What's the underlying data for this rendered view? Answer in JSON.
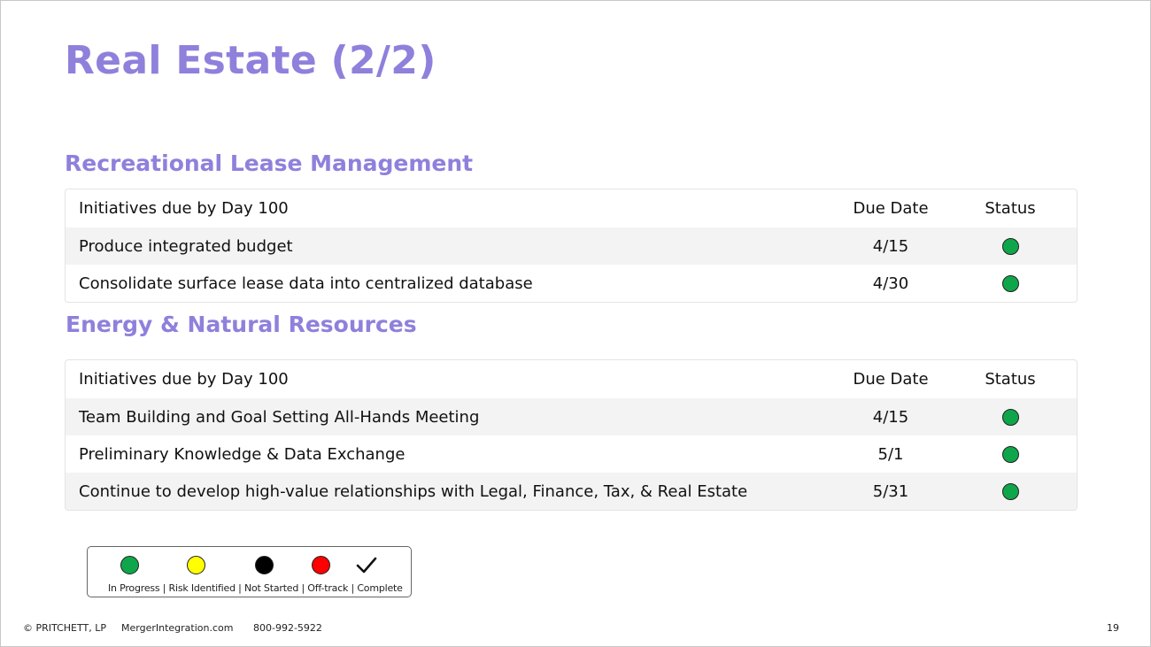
{
  "title": "Real Estate (2/2)",
  "colors": {
    "accent": "#8f80dc",
    "in_progress": "#0fa64b",
    "risk_identified": "#ffff00",
    "not_started": "#000000",
    "off_track": "#ff0000",
    "row_alt": "#f3f3f3"
  },
  "sections": [
    {
      "title": "Recreational Lease Management",
      "headers": {
        "initiative": "Initiatives due by Day 100",
        "due_date": "Due Date",
        "status": "Status"
      },
      "rows": [
        {
          "initiative": "Produce integrated budget",
          "due_date": "4/15",
          "status": "in-progress"
        },
        {
          "initiative": "Consolidate surface lease data into centralized database",
          "due_date": "4/30",
          "status": "in-progress"
        }
      ]
    },
    {
      "title": "Energy & Natural Resources",
      "headers": {
        "initiative": "Initiatives due by Day 100",
        "due_date": "Due Date",
        "status": "Status"
      },
      "rows": [
        {
          "initiative": "Team Building and Goal Setting All-Hands Meeting",
          "due_date": "4/15",
          "status": "in-progress"
        },
        {
          "initiative": "Preliminary Knowledge & Data Exchange",
          "due_date": "5/1",
          "status": "in-progress"
        },
        {
          "initiative": "Continue to develop high-value relationships with Legal, Finance, Tax, & Real Estate",
          "due_date": "5/31",
          "status": "in-progress"
        }
      ]
    }
  ],
  "legend": {
    "labels": "In Progress | Risk Identified  | Not Started | Off-track | Complete",
    "icons": [
      "green-circle-icon",
      "yellow-circle-icon",
      "black-circle-icon",
      "red-circle-icon",
      "checkmark-icon"
    ]
  },
  "footer": {
    "copyright": "© PRITCHETT, LP",
    "website": "MergerIntegration.com",
    "phone": "800-992-5922",
    "page_number": "19"
  }
}
